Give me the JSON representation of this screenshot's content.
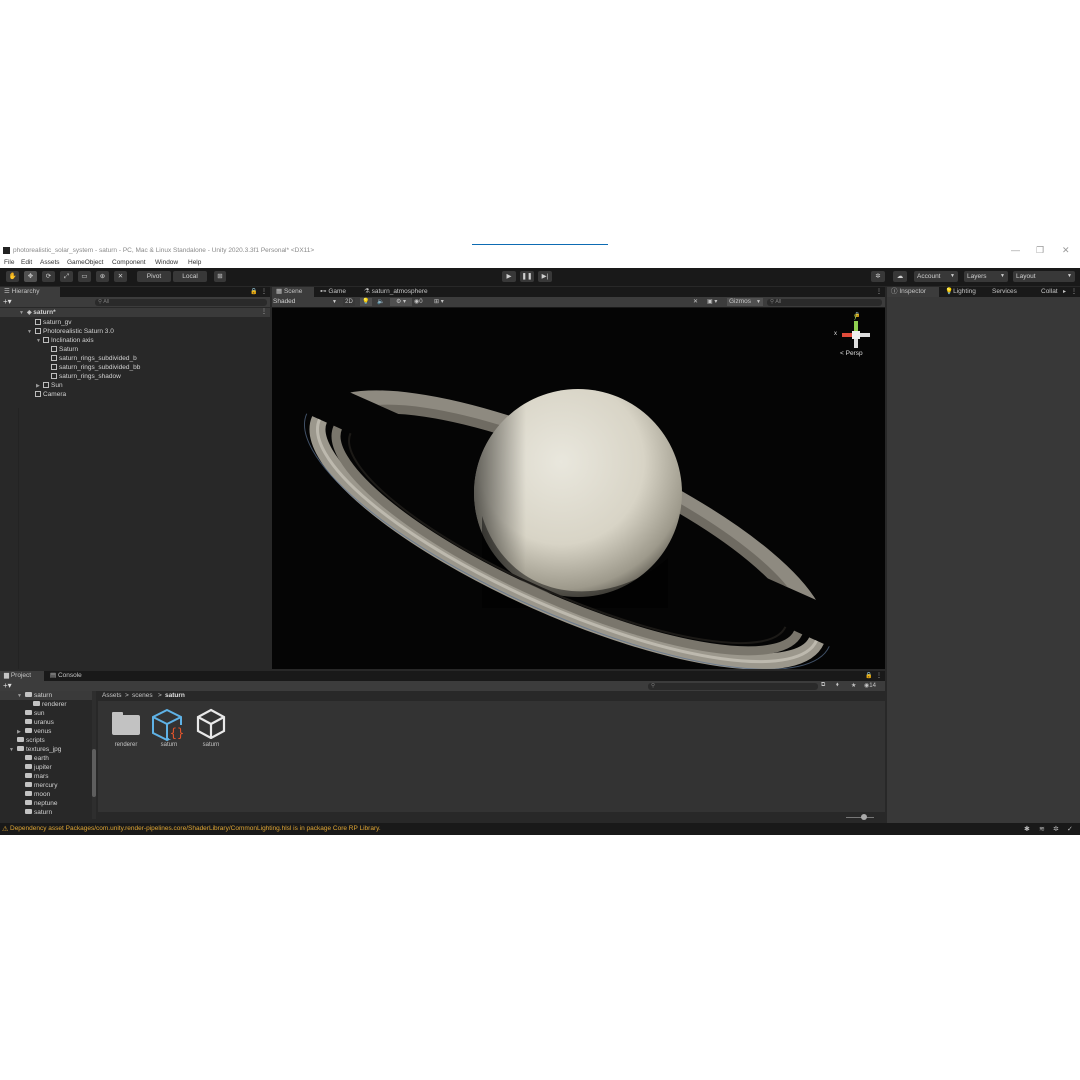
{
  "window": {
    "title": "photorealistic_solar_system - saturn - PC, Mac & Linux Standalone - Unity 2020.3.3f1 Personal* <DX11>",
    "controls": [
      "—",
      "❐",
      "✕"
    ]
  },
  "menu": [
    "File",
    "Edit",
    "Assets",
    "GameObject",
    "Component",
    "Window",
    "Help"
  ],
  "toolbar": {
    "pivot": "Pivot",
    "local": "Local",
    "account": "Account",
    "layers": "Layers",
    "layout": "Layout"
  },
  "hierarchy": {
    "tab": "Hierarchy",
    "search_placeholder": "All",
    "scene_name": "saturn*",
    "items": [
      {
        "label": "saturn_gv"
      },
      {
        "label": "Photorealistic Saturn 3.0"
      },
      {
        "label": "Inclination axis"
      },
      {
        "label": "Saturn"
      },
      {
        "label": "saturn_rings_subdivided_b"
      },
      {
        "label": "saturn_rings_subdivided_bb"
      },
      {
        "label": "saturn_rings_shadow"
      },
      {
        "label": "Sun"
      },
      {
        "label": "Camera"
      }
    ]
  },
  "scene_view": {
    "tabs": [
      "Scene",
      "Game",
      "saturn_atmosphere"
    ],
    "shading_mode": "Shaded",
    "mode_2d": "2D",
    "hidden_count": "0",
    "gizmos": "Gizmos",
    "search_placeholder": "All",
    "gizmo_axis_y": "y",
    "gizmo_axis_x": "x",
    "projection": "Persp"
  },
  "inspector": {
    "tabs": [
      "Inspector",
      "Lighting",
      "Services",
      "Collat"
    ]
  },
  "project": {
    "tabs": [
      "Project",
      "Console"
    ],
    "tree": [
      {
        "label": "saturn"
      },
      {
        "label": "renderer"
      },
      {
        "label": "sun"
      },
      {
        "label": "uranus"
      },
      {
        "label": "venus"
      },
      {
        "label": "scripts"
      },
      {
        "label": "textures_jpg"
      },
      {
        "label": "earth"
      },
      {
        "label": "jupiter"
      },
      {
        "label": "mars"
      },
      {
        "label": "mercury"
      },
      {
        "label": "moon"
      },
      {
        "label": "neptune"
      },
      {
        "label": "saturn"
      }
    ],
    "breadcrumb": [
      "Assets",
      "scenes",
      "saturn"
    ],
    "hidden_count": "14",
    "assets": [
      {
        "label": "renderer",
        "icon": "folder-icon"
      },
      {
        "label": "saturn",
        "icon": "prefab-script-icon"
      },
      {
        "label": "saturn",
        "icon": "unity-scene-icon"
      }
    ]
  },
  "status": {
    "message": "Dependency asset Packages/com.unity.render-pipelines.core/ShaderLibrary/CommonLighting.hlsl is in package Core RP Library."
  }
}
